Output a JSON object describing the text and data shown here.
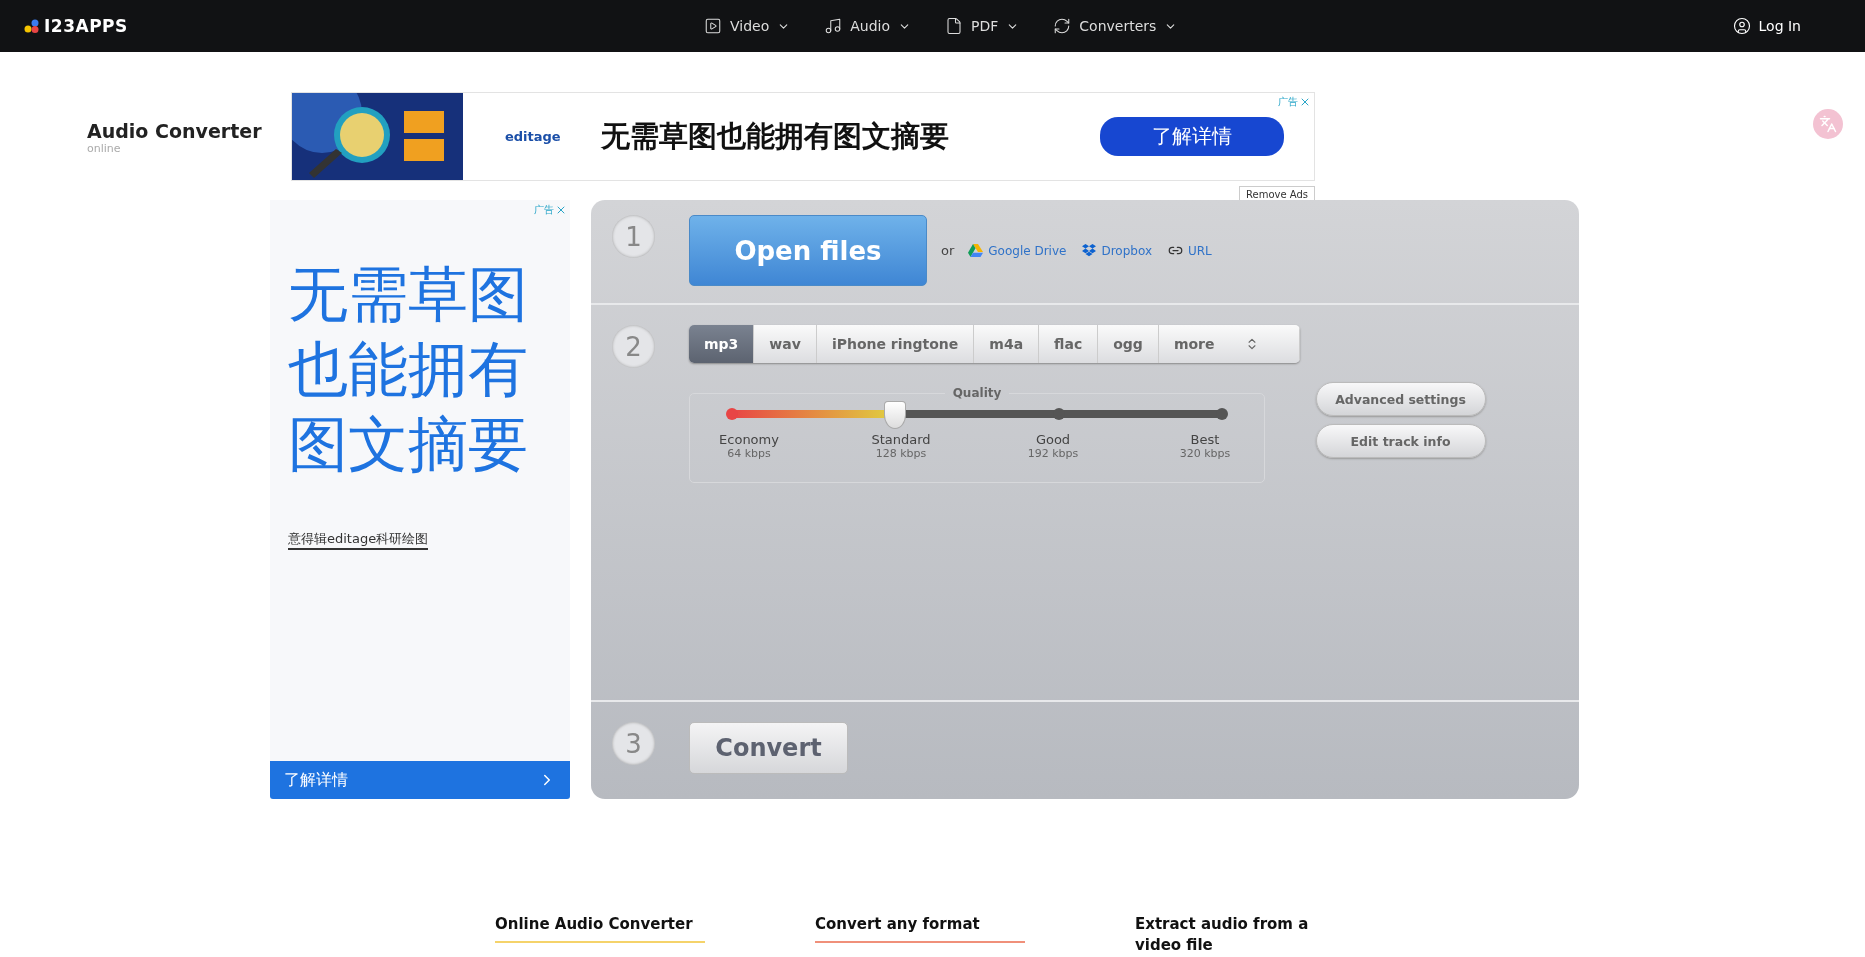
{
  "nav": {
    "logo": "I23APPS",
    "menu": [
      {
        "label": "Video",
        "kind": "video"
      },
      {
        "label": "Audio",
        "kind": "audio"
      },
      {
        "label": "PDF",
        "kind": "pdf"
      },
      {
        "label": "Converters",
        "kind": "converters"
      }
    ],
    "login": "Log In"
  },
  "app_title": {
    "title": "Audio Converter",
    "subtitle": "online"
  },
  "top_ad": {
    "kind": "picture",
    "brand": "editage",
    "headline": "无需草图也能拥有图文摘要",
    "button": "了解详情",
    "ad_label": "广告"
  },
  "remove_ads": "Remove Ads",
  "side_ad": {
    "ad_label": "广告",
    "headline_lines": [
      "无需草图",
      "也能拥有",
      "图文摘要"
    ],
    "link": "意得辑editage科研绘图",
    "button": "了解详情"
  },
  "steps": {
    "step1": {
      "number": "1",
      "button": "Open files",
      "or": "or",
      "sources": [
        {
          "label": "Google Drive",
          "kind": "drive"
        },
        {
          "label": "Dropbox",
          "kind": "dropbox"
        },
        {
          "label": "URL",
          "kind": "url"
        }
      ]
    },
    "step2": {
      "number": "2",
      "formats": [
        {
          "label": "mp3",
          "selected": true
        },
        {
          "label": "wav",
          "selected": false
        },
        {
          "label": "iPhone ringtone",
          "selected": false
        },
        {
          "label": "m4a",
          "selected": false
        },
        {
          "label": "flac",
          "selected": false
        },
        {
          "label": "ogg",
          "selected": false
        },
        {
          "label": "more",
          "selected": false
        }
      ],
      "quality": {
        "title": "Quality",
        "level": 0.333,
        "stops": [
          {
            "name": "Economy",
            "rate": "64 kbps"
          },
          {
            "name": "Standard",
            "rate": "128 kbps"
          },
          {
            "name": "Good",
            "rate": "192 kbps"
          },
          {
            "name": "Best",
            "rate": "320 kbps"
          }
        ]
      },
      "buttons": [
        "Advanced settings",
        "Edit track info"
      ]
    },
    "step3": {
      "number": "3",
      "button": "Convert"
    }
  },
  "footer_headings": [
    {
      "title": "Online Audio Converter",
      "color": "#f5d36a"
    },
    {
      "title": "Convert any format",
      "color": "#f0907a"
    },
    {
      "title": "Extract audio from a video file"
    }
  ]
}
